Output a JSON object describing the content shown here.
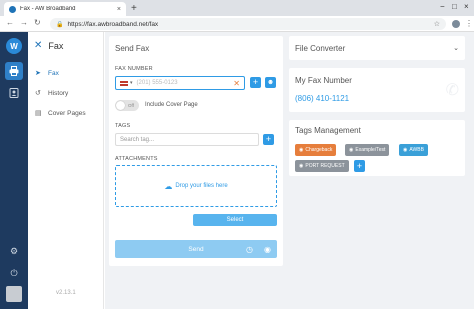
{
  "browser": {
    "tab_title": "Fax - AW Broadband",
    "tab_close": "×",
    "new_tab": "+",
    "window_controls": [
      "−",
      "□",
      "×"
    ],
    "url": "https://fax.awbroadband.net/fax",
    "lock_icon": "lock-icon",
    "star_icon": "star-icon"
  },
  "rail": {
    "logo": "W",
    "items": [
      {
        "name": "fax",
        "icon": "printer-icon",
        "active": true
      },
      {
        "name": "contacts",
        "icon": "contacts-icon",
        "active": false
      }
    ],
    "bottom": [
      {
        "name": "settings",
        "icon": "gear-icon"
      },
      {
        "name": "power",
        "icon": "power-icon"
      }
    ]
  },
  "sidebar": {
    "title": "Fax",
    "items": [
      {
        "label": "Fax",
        "active": true
      },
      {
        "label": "History",
        "active": false
      },
      {
        "label": "Cover Pages",
        "active": false
      }
    ],
    "version": "v2.13.1"
  },
  "send_fax": {
    "title": "Send Fax",
    "fax_number_label": "FAX NUMBER",
    "fax_number_placeholder": "(201) 555-0123",
    "toggle_label": "Off",
    "cover_page_label": "Include Cover Page",
    "tags_label": "TAGS",
    "tags_placeholder": "Search tag...",
    "attachments_label": "ATTACHMENTS",
    "drop_text": "Drop your files here",
    "select_label": "Select",
    "send_label": "Send"
  },
  "file_converter": {
    "title": "File Converter"
  },
  "my_fax_number": {
    "title": "My Fax Number",
    "number": "(806) 410-1121"
  },
  "tags_management": {
    "title": "Tags Management",
    "tags": [
      {
        "label": "Chargeback",
        "color": "#e67e3c"
      },
      {
        "label": "Example/Test",
        "color": "#8c939b"
      },
      {
        "label": "AWBB",
        "color": "#3aa0d8"
      },
      {
        "label": "PORT REQUEST",
        "color": "#8c939b"
      }
    ]
  },
  "colors": {
    "accent": "#2f9be5",
    "rail": "#1e3a5f",
    "primary_blue": "#1f73b7"
  }
}
